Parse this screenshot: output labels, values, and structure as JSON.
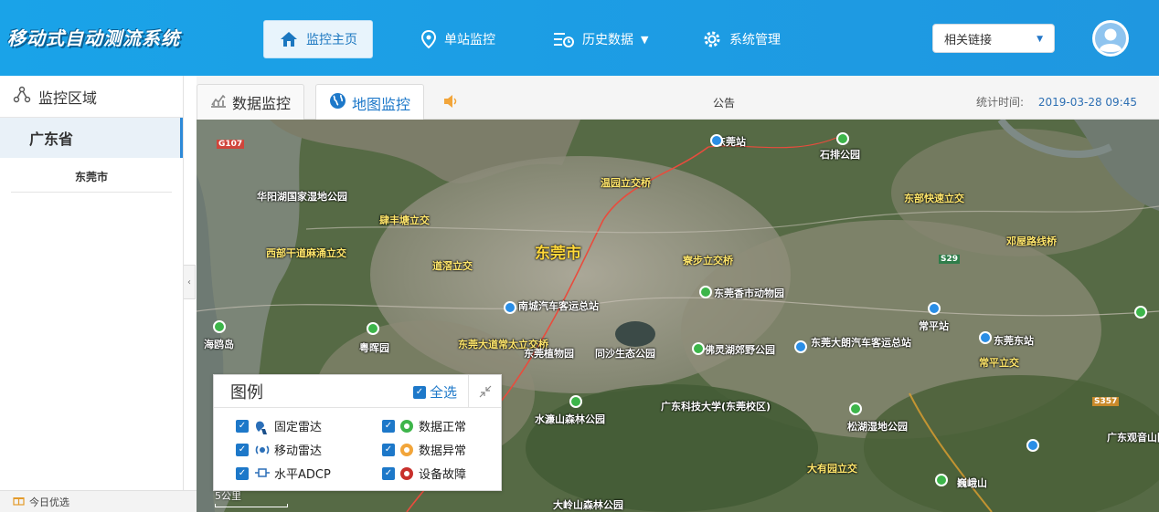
{
  "app": {
    "title": "移动式自动测流系统"
  },
  "nav": {
    "items": [
      {
        "label": "监控主页",
        "icon": "home-icon"
      },
      {
        "label": "单站监控",
        "icon": "location-pin-icon"
      },
      {
        "label": "历史数据",
        "icon": "history-list-icon"
      },
      {
        "label": "系统管理",
        "icon": "gear-icon"
      }
    ],
    "dropdown_caret": "▼"
  },
  "links": {
    "selected": "相关链接",
    "caret": "▼"
  },
  "sidebar": {
    "title": "监控区域",
    "province": "广东省",
    "city": "东莞市",
    "collapse": "‹"
  },
  "footer": {
    "label": "今日优选"
  },
  "tabs": {
    "items": [
      {
        "label": "数据监控",
        "icon": "chart-icon"
      },
      {
        "label": "地图监控",
        "icon": "globe-icon"
      }
    ]
  },
  "notice": "公告",
  "stat": {
    "label": "统计时间:",
    "value": "2019-03-28 09:45"
  },
  "map": {
    "labels": [
      "东莞站",
      "石排公园",
      "温园立交桥",
      "华阳湖国家湿地公园",
      "肆丰塘立交",
      "东部快速立交",
      "邓屋路线桥",
      "东莞市",
      "西部干道麻涌立交",
      "道滘立交",
      "寮步立交桥",
      "东莞香市动物园",
      "南城汽车客运总站",
      "常平站",
      "东莞东站",
      "海鸥岛",
      "粤晖园",
      "东莞大道常太立交桥",
      "东莞植物园",
      "同沙生态公园",
      "佛灵湖郊野公园",
      "东莞大朗汽车客运总站",
      "常平立交",
      "广东科技大学(东莞校区)",
      "水濂山森林公园",
      "松湖湿地公园",
      "大岭山森林公园",
      "大有园立交",
      "广东观音山国家森林公园",
      "巍峨山",
      "G107",
      "S29",
      "S357"
    ],
    "scale": "5公里"
  },
  "legend": {
    "title": "图例",
    "select_all": "全选",
    "items": [
      {
        "label": "固定雷达",
        "icon": "fixed-radar-icon"
      },
      {
        "label": "移动雷达",
        "icon": "mobile-radar-icon"
      },
      {
        "label": "水平ADCP",
        "icon": "horizontal-adcp-icon"
      },
      {
        "label": "数据正常",
        "icon": "status-normal-icon",
        "color": "#3db54a"
      },
      {
        "label": "数据异常",
        "icon": "status-abnormal-icon",
        "color": "#f2a53a"
      },
      {
        "label": "设备故障",
        "icon": "device-fault-icon",
        "color": "#c8302c"
      }
    ]
  },
  "colors": {
    "header": "#1aa3e8",
    "accent": "#1d78c9"
  }
}
